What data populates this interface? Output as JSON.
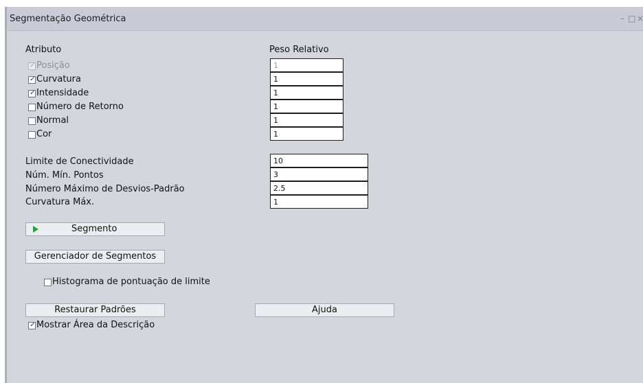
{
  "window": {
    "title": "Segmentação Geométrica",
    "minimize_glyph": "–",
    "maximize_glyph": "□",
    "close_glyph": "×"
  },
  "attributes": {
    "header_attribute": "Atributo",
    "header_weight": "Peso Relativo",
    "items": [
      {
        "label": "Posição",
        "checked": true,
        "disabled": true,
        "weight": "1"
      },
      {
        "label": "Curvatura",
        "checked": true,
        "disabled": false,
        "weight": "1"
      },
      {
        "label": "Intensidade",
        "checked": true,
        "disabled": false,
        "weight": "1"
      },
      {
        "label": "Número de Retorno",
        "checked": false,
        "disabled": false,
        "weight": "1"
      },
      {
        "label": "Normal",
        "checked": false,
        "disabled": false,
        "weight": "1"
      },
      {
        "label": "Cor",
        "checked": false,
        "disabled": false,
        "weight": "1"
      }
    ]
  },
  "parameters": [
    {
      "label": "Limite de Conectividade",
      "value": "10"
    },
    {
      "label": "Núm. Mín. Pontos",
      "value": "3"
    },
    {
      "label": "Número Máximo de Desvios-Padrão",
      "value": "2.5"
    },
    {
      "label": "Curvatura Máx.",
      "value": "1"
    }
  ],
  "buttons": {
    "segment": "Segmento",
    "segment_manager": "Gerenciador de Segmentos",
    "restore_defaults": "Restaurar Padrões",
    "help": "Ajuda"
  },
  "options": {
    "histogram_label": "Histograma de pontuação de limite",
    "histogram_checked": false,
    "show_description_label": "Mostrar Área da Descrição",
    "show_description_checked": true
  },
  "glyphs": {
    "check": "✓"
  },
  "colors": {
    "play_icon": "#1fa33b",
    "panel_bg": "#d4d6de",
    "title_bg": "#c9ccd6"
  }
}
